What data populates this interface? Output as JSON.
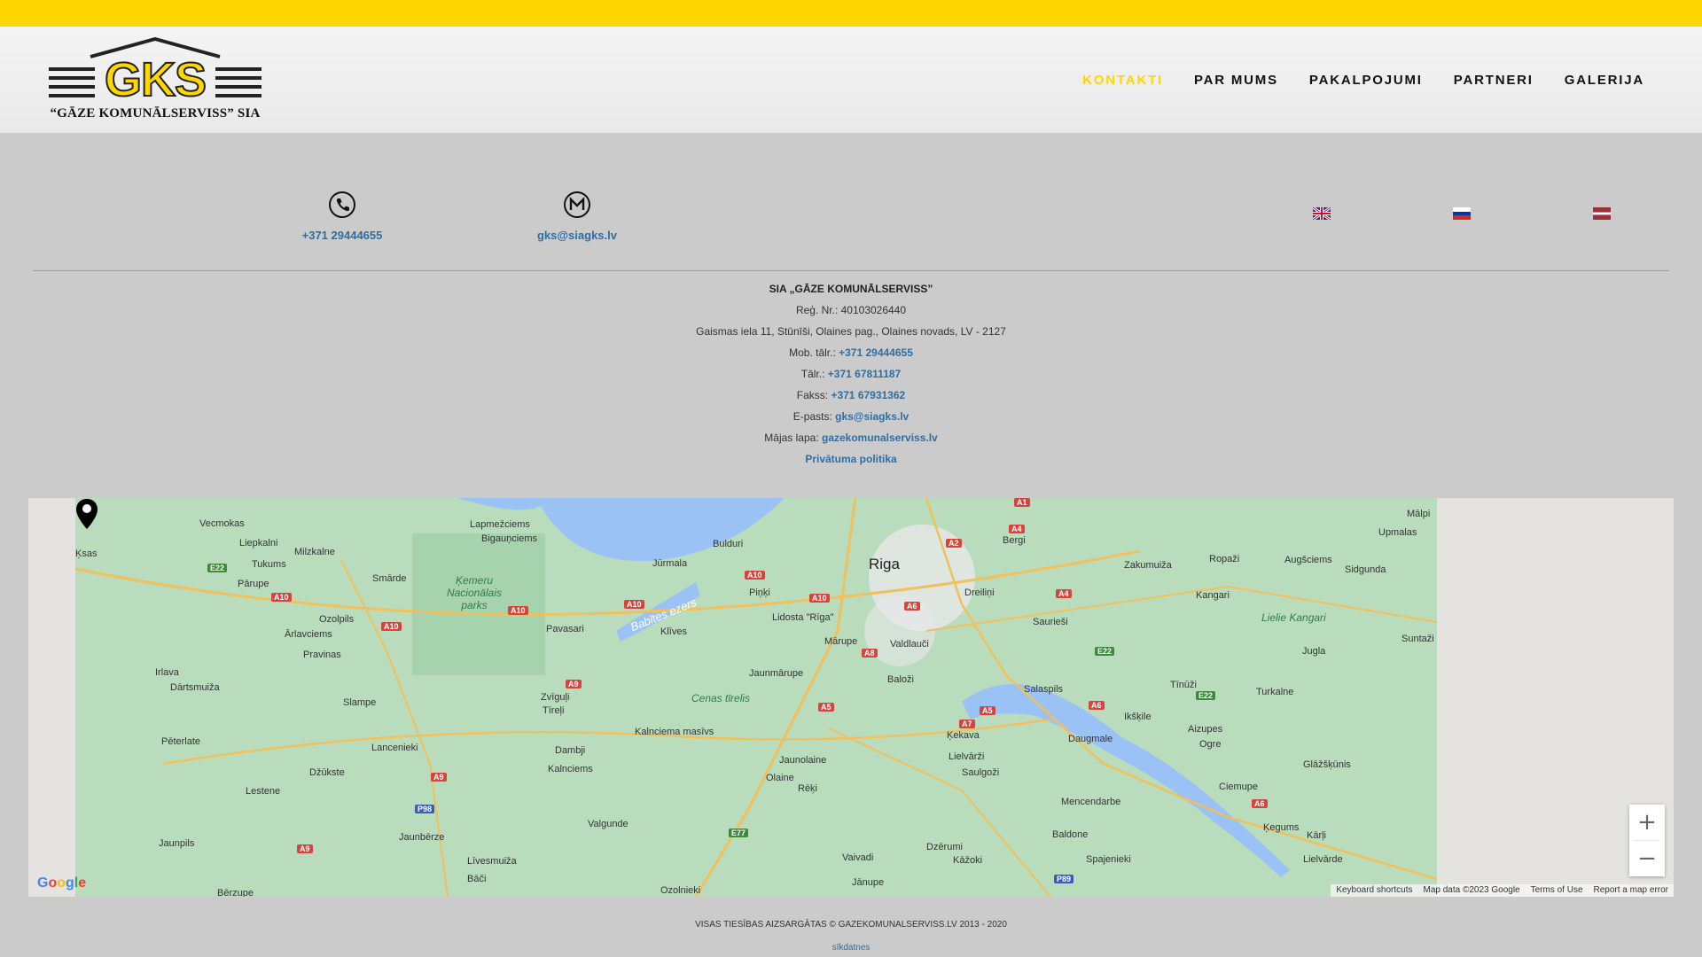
{
  "logo": {
    "mark": "GKS",
    "subtitle": "“GĀZE KOMUNĀLSERVISS” SIA"
  },
  "nav": {
    "items": [
      {
        "label": "KONTAKTI",
        "active": true
      },
      {
        "label": "PAR MUMS"
      },
      {
        "label": "PAKALPOJUMI"
      },
      {
        "label": "PARTNERI"
      },
      {
        "label": "GALERIJA"
      }
    ]
  },
  "contacts": {
    "phone": "+371 29444655",
    "email": "gks@siagks.lv"
  },
  "languages": [
    "en",
    "ru",
    "lv"
  ],
  "company": {
    "title": "SIA „GĀZE KOMUNĀLSERVISS”",
    "reg": "Reģ. Nr.: 40103026440",
    "address": "Gaismas iela 11, Stūnīši, Olaines pag., Olaines novads, LV - 2127",
    "mob_label": "Mob. tālr.: ",
    "mob_value": "+371 29444655",
    "tel_label": "Tālr.: ",
    "tel_value": "+371 67811187",
    "fax_label": "Fakss: ",
    "fax_value": "+371 67931362",
    "email_label": "E-pasts: ",
    "email_value": "gks@siagks.lv",
    "web_label": "Mājas lapa: ",
    "web_value": "gazekomunalserviss.lv",
    "privacy": "Privātuma politika"
  },
  "map": {
    "city": "Riga",
    "places": [
      "Vecmokas",
      "Liepkalni",
      "Milzkalne",
      "Tukums",
      "Pārupe",
      "Smārde",
      "Ozolpils",
      "Ārlavciems",
      "Pravinas",
      "Irlava",
      "Dārtsmuiža",
      "Slampe",
      "Pēterlate",
      "Lancenieki",
      "Džūkste",
      "Lestene",
      "Jaunpils",
      "Jaunbērze",
      "Līvesmuiža",
      "Bāči",
      "Bērzupe",
      "Lapmežciems",
      "Bigauņciems",
      "Bulduri",
      "Jūrmala",
      "Piņķi",
      "Lidosta \"Rīga\"",
      "Pavasari",
      "Klīves",
      "Mārupe",
      "Valdlauči",
      "Jaunmārupe",
      "Baloži",
      "Zvīguļi",
      "Tīreļi",
      "Kalnciema masīvs",
      "Dambji",
      "Kalnciems",
      "Valgunde",
      "Jaunolaine",
      "Olaine",
      "Rēķi",
      "Ķekava",
      "Lielvārži",
      "Saulgoži",
      "Dzērumi",
      "Vaivadi",
      "Kāžoki",
      "Jānupe",
      "Ozolnieki",
      "Bergi",
      "Dreiliņi",
      "Zakumuiža",
      "Ropaži",
      "Augšciems",
      "Kangari",
      "Sidgunda",
      "Mālpi",
      "Upmalas",
      "Saurieši",
      "Jugla",
      "Suntaži",
      "Salaspils",
      "Tīnūži",
      "Turkalne",
      "Ikšķile",
      "Aizupes",
      "Ogre",
      "Daugmale",
      "Glāžšķūnis",
      "Ciemupe",
      "Mencendarbe",
      "Baldone",
      "Ķegums",
      "Kārļi",
      "Spajenieki",
      "Lielvārde",
      "Ķsas"
    ],
    "water_labels": [
      "Babītes ezers"
    ],
    "park_labels": [
      "Ķemeru Nacionālais parks",
      "Cenas tīrelis",
      "Lielie Kangari"
    ],
    "google": "Google",
    "attribution": [
      "Keyboard shortcuts",
      "Map data ©2023 Google",
      "Terms of Use",
      "Report a map error"
    ],
    "zoom_in": "+",
    "zoom_out": "−"
  },
  "footer": {
    "copyright": "VISAS TIESĪBAS AIZSARGĀTAS © GAZEKOMUNALSERVISS.LV 2013 - 2020",
    "cookies": "sīkdatnes"
  },
  "colors": {
    "accent": "#ffd700",
    "link": "#2e6ea3",
    "background": "#cbcbcb"
  },
  "icons": [
    "phone-icon",
    "email-icon",
    "map-pin-icon"
  ]
}
